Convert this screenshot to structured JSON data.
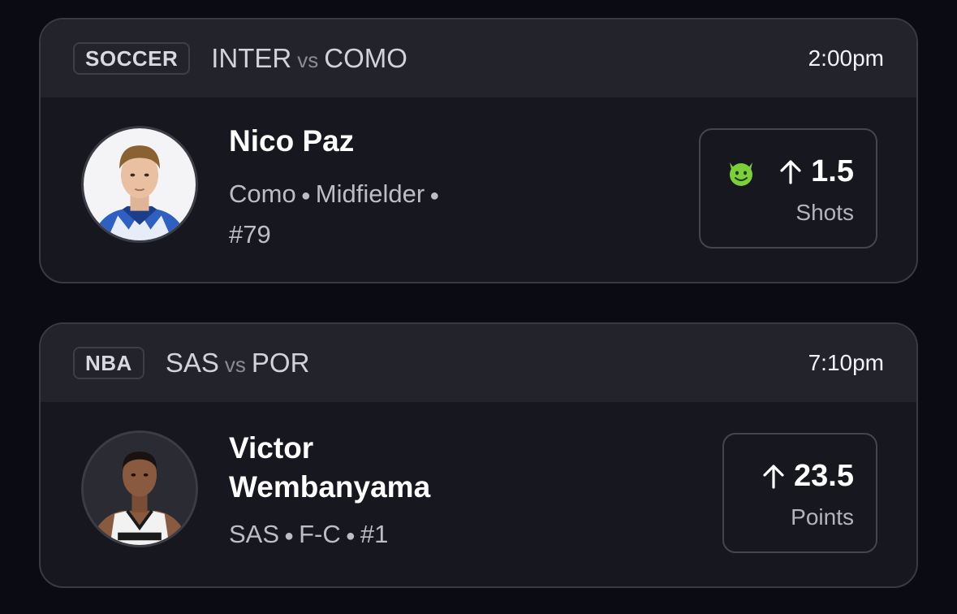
{
  "cards": [
    {
      "sport": "SOCCER",
      "team_home": "INTER",
      "vs": "vs",
      "team_away": "COMO",
      "time": "2:00pm",
      "player_name": "Nico Paz",
      "meta": [
        "Como",
        "Midfielder",
        "#79"
      ],
      "projection_value": "1.5",
      "projection_stat": "Shots",
      "projection_direction": "up",
      "icon": "green-demon-icon",
      "accent": "#7ccf3a"
    },
    {
      "sport": "NBA",
      "team_home": "SAS",
      "vs": "vs",
      "team_away": "POR",
      "time": "7:10pm",
      "player_name": "Victor Wembanyama",
      "meta": [
        "SAS",
        "F-C",
        "#1"
      ],
      "projection_value": "23.5",
      "projection_stat": "Points",
      "projection_direction": "up"
    }
  ],
  "colors": {
    "background": "#0b0b14",
    "card": "#17171f",
    "header": "#23232c",
    "border": "#3a3a44"
  }
}
